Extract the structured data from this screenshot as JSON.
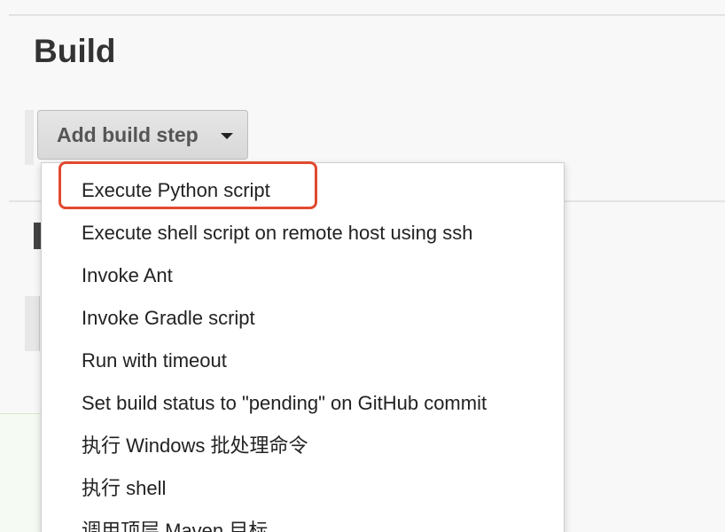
{
  "section": {
    "title": "Build"
  },
  "toolbar": {
    "add_build_step_label": "Add build step",
    "caret_icon": "caret-down-icon"
  },
  "dropdown": {
    "items": [
      {
        "label": "Execute Python script"
      },
      {
        "label": "Execute shell script on remote host using ssh"
      },
      {
        "label": "Invoke Ant"
      },
      {
        "label": "Invoke Gradle script"
      },
      {
        "label": "Run with timeout"
      },
      {
        "label": "Set build status to \"pending\" on GitHub commit"
      },
      {
        "label": "执行 Windows 批处理命令"
      },
      {
        "label": "执行 shell"
      },
      {
        "label": "调用顶层 Maven 目标"
      }
    ]
  },
  "annotation": {
    "highlight_color": "#e2492f",
    "highlighted_item": "Execute Python script"
  }
}
